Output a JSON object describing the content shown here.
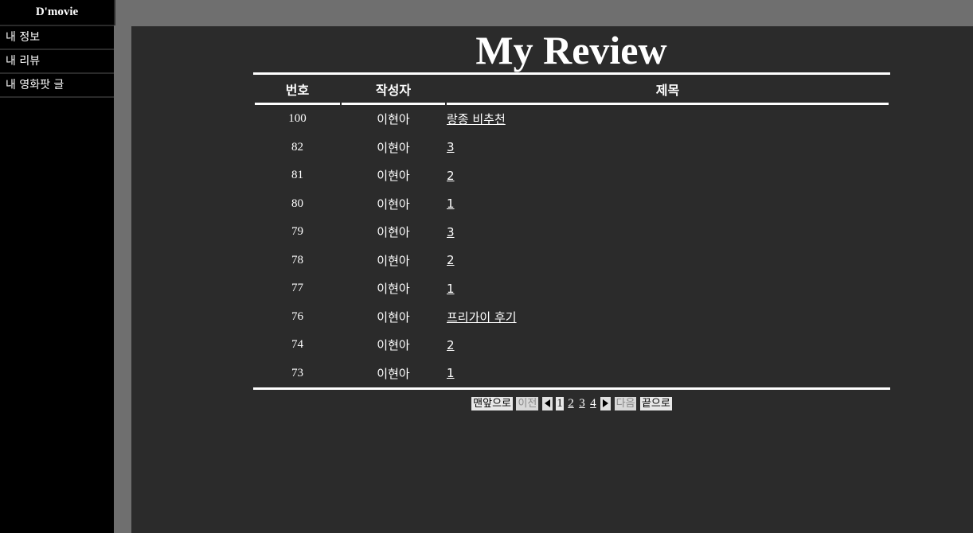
{
  "sidebar": {
    "brand": "D'movie",
    "items": [
      {
        "label": "내 정보"
      },
      {
        "label": "내 리뷰"
      },
      {
        "label": "내 영화팟 글"
      }
    ]
  },
  "main": {
    "title": "My Review",
    "table": {
      "headers": {
        "no": "번호",
        "writer": "작성자",
        "title": "제목"
      },
      "rows": [
        {
          "no": "100",
          "writer": "이현아",
          "title": "랑종 비추천"
        },
        {
          "no": "82",
          "writer": "이현아",
          "title": "3"
        },
        {
          "no": "81",
          "writer": "이현아",
          "title": "2"
        },
        {
          "no": "80",
          "writer": "이현아",
          "title": "1"
        },
        {
          "no": "79",
          "writer": "이현아",
          "title": "3"
        },
        {
          "no": "78",
          "writer": "이현아",
          "title": "2"
        },
        {
          "no": "77",
          "writer": "이현아",
          "title": "1"
        },
        {
          "no": "76",
          "writer": "이현아",
          "title": "프리가이 후기"
        },
        {
          "no": "74",
          "writer": "이현아",
          "title": "2"
        },
        {
          "no": "73",
          "writer": "이현아",
          "title": "1"
        }
      ]
    },
    "pager": {
      "first": "맨앞으로",
      "prev": "이전",
      "pages": [
        "1",
        "2",
        "3",
        "4"
      ],
      "current": "1",
      "next": "다음",
      "last": "끝으로"
    }
  }
}
